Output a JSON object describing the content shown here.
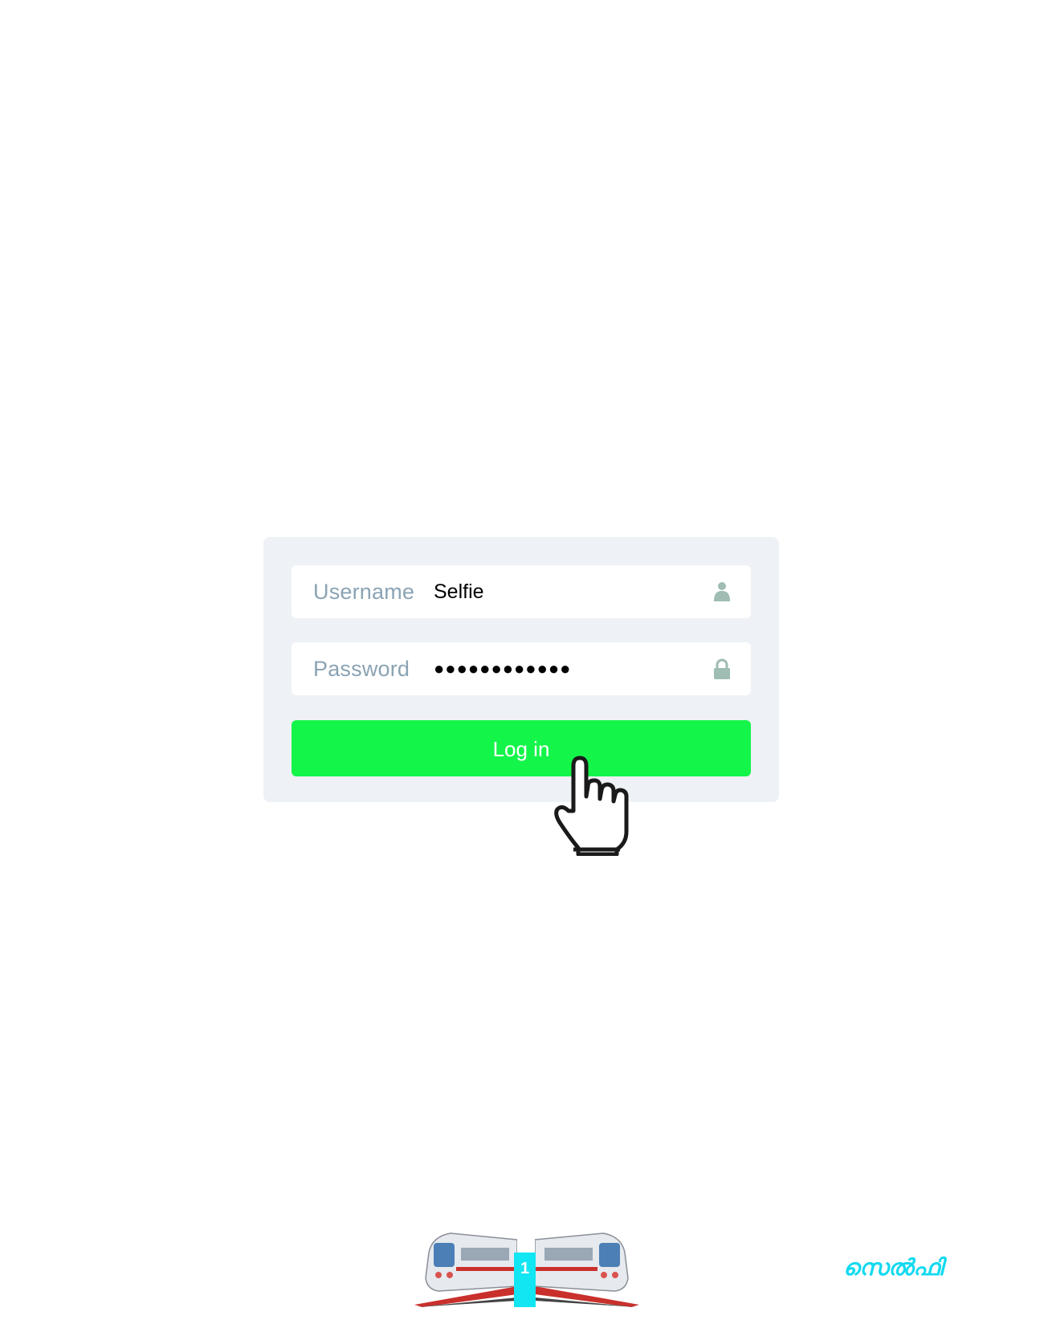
{
  "login": {
    "username_label": "Username",
    "username_value": "Selfie",
    "password_label": "Password",
    "password_value": "●●●●●●●●●●●●",
    "login_label": "Log in",
    "colors": {
      "card_bg": "#eef1f5",
      "button": "#14f54a",
      "label": "#8aa3b3",
      "icon": "#9fbdb2"
    },
    "icons": {
      "username": "person-icon",
      "password": "lock-icon",
      "cursor": "hand-cursor-icon"
    }
  },
  "footer": {
    "page_number": "1",
    "brand": "സെൽഫി",
    "colors": {
      "accent": "#12e6f2"
    }
  }
}
